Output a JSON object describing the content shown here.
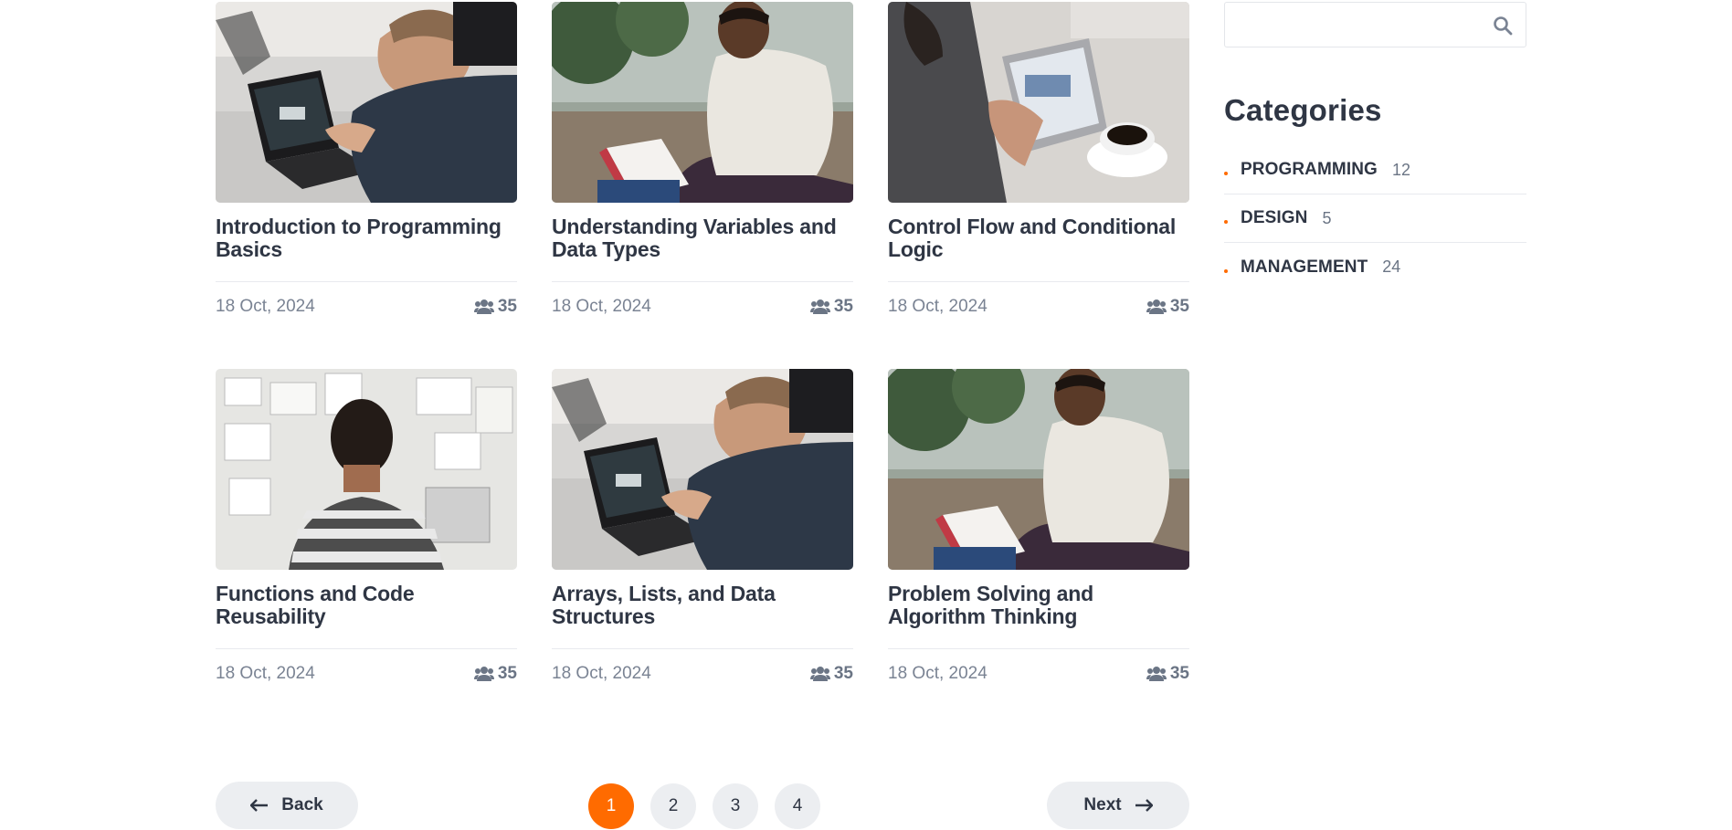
{
  "courses": [
    {
      "title": "Introduction to Programming Basics",
      "date": "18 Oct, 2024",
      "students": "35",
      "image": "man-laptop"
    },
    {
      "title": "Understanding Variables and Data Types",
      "date": "18 Oct, 2024",
      "students": "35",
      "image": "man-reading-outdoors"
    },
    {
      "title": "Control Flow and Conditional Logic",
      "date": "18 Oct, 2024",
      "students": "35",
      "image": "tablet-coffee"
    },
    {
      "title": "Functions and Code Reusability",
      "date": "18 Oct, 2024",
      "students": "35",
      "image": "man-whiteboard"
    },
    {
      "title": "Arrays, Lists, and Data Structures",
      "date": "18 Oct, 2024",
      "students": "35",
      "image": "man-laptop"
    },
    {
      "title": "Problem Solving and Algorithm Thinking",
      "date": "18 Oct, 2024",
      "students": "35",
      "image": "man-reading-outdoors"
    }
  ],
  "search": {
    "placeholder": "",
    "icon": "search-icon"
  },
  "categories": {
    "title": "Categories",
    "items": [
      {
        "name": "PROGRAMMING",
        "count": "12"
      },
      {
        "name": "DESIGN",
        "count": "5"
      },
      {
        "name": "MANAGEMENT",
        "count": "24"
      }
    ]
  },
  "pagination": {
    "back_label": "Back",
    "next_label": "Next",
    "pages": [
      "1",
      "2",
      "3",
      "4"
    ],
    "current_page": "1"
  },
  "colors": {
    "accent": "#ff6b00",
    "pill_bg": "#eceef1",
    "heading": "#2f3644",
    "muted": "#7a8393"
  }
}
